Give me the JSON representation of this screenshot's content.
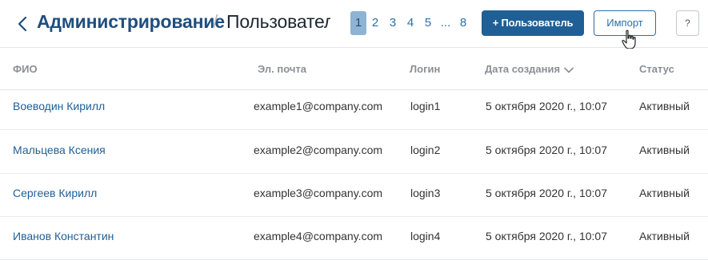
{
  "header": {
    "breadcrumb_root": "Администрирование",
    "breadcrumb_separator": "/",
    "breadcrumb_current": "Пользователи",
    "back_icon": "chevron-left-icon"
  },
  "pagination": {
    "pages": [
      "1",
      "2",
      "3",
      "4",
      "5",
      "...",
      "8"
    ],
    "active": "1"
  },
  "actions": {
    "add_user_label": "+ Пользователь",
    "import_label": "Импорт",
    "help_label": "?"
  },
  "table": {
    "columns": {
      "name": "ФИО",
      "email": "Эл. почта",
      "login": "Логин",
      "created": "Дата создания",
      "status": "Статус"
    },
    "rows": [
      {
        "name": "Воеводин Кирилл",
        "email": "example1@company.com",
        "login": "login1",
        "created": "5 октября 2020 г., 10:07",
        "status": "Активный"
      },
      {
        "name": "Мальцева Ксения",
        "email": "example2@company.com",
        "login": "login2",
        "created": "5 октября 2020 г., 10:07",
        "status": "Активный"
      },
      {
        "name": "Сергеев Кирилл",
        "email": "example3@company.com",
        "login": "login3",
        "created": "5 октября 2020 г., 10:07",
        "status": "Активный"
      },
      {
        "name": "Иванов Константин",
        "email": "example4@company.com",
        "login": "login4",
        "created": "5 октября 2020 г., 10:07",
        "status": "Активный"
      }
    ]
  },
  "colors": {
    "accent": "#1f5f96",
    "link": "#2f6ea5",
    "active_page": "#8fb3d2"
  }
}
